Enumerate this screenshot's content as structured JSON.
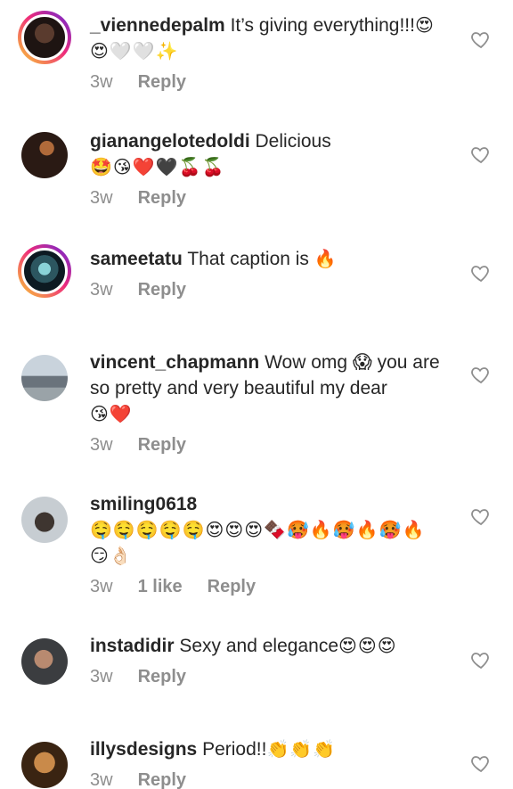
{
  "comments": [
    {
      "username": "_viennedepalm",
      "text": "It’s giving everything!!!",
      "emojis": "😍😍🤍🤍✨",
      "time": "3w",
      "likes": "",
      "reply_label": "Reply",
      "avatar_icon": "profile-photo-woman",
      "has_story_ring": true
    },
    {
      "username": "gianangelotedoldi",
      "text": "Delicious",
      "emojis": "🤩😘❤️🖤🍒🍒",
      "time": "3w",
      "likes": "",
      "reply_label": "Reply",
      "avatar_icon": "profile-photo-man",
      "has_story_ring": false
    },
    {
      "username": "sameetatu",
      "text": "That caption is",
      "emojis": "🔥",
      "time": "3w",
      "likes": "",
      "reply_label": "Reply",
      "avatar_icon": "profile-photo-futuristic",
      "has_story_ring": true
    },
    {
      "username": "vincent_chapmann",
      "text": "Wow omg 😱 you are so pretty and very beautiful my dear",
      "emojis": "😘❤️",
      "time": "3w",
      "likes": "",
      "reply_label": "Reply",
      "avatar_icon": "profile-photo-statue",
      "has_story_ring": false
    },
    {
      "username": "smiling0618",
      "text": "",
      "emojis": "🤤🤤🤤🤤🤤😍😍😍🍫🥵🔥🥵🔥🥵🔥😏👌🏻",
      "time": "3w",
      "likes": "1 like",
      "reply_label": "Reply",
      "avatar_icon": "profile-photo-man",
      "has_story_ring": false
    },
    {
      "username": "instadidir",
      "text": "Sexy and elegance",
      "emojis": "😍😍😍",
      "time": "3w",
      "likes": "",
      "reply_label": "Reply",
      "avatar_icon": "profile-photo-man",
      "has_story_ring": false
    },
    {
      "username": "illysdesigns",
      "text": "Period!!",
      "emojis": "👏👏👏",
      "time": "3w",
      "likes": "",
      "reply_label": "Reply",
      "avatar_icon": "profile-photo-woman",
      "has_story_ring": false
    }
  ],
  "colors": {
    "text": "#262626",
    "meta": "#8e8e8e",
    "story_ring_start": "#f9ce34",
    "story_ring_mid": "#ee2a7b",
    "story_ring_end": "#6228d7"
  },
  "icons": {
    "like": "heart-outline-icon"
  }
}
